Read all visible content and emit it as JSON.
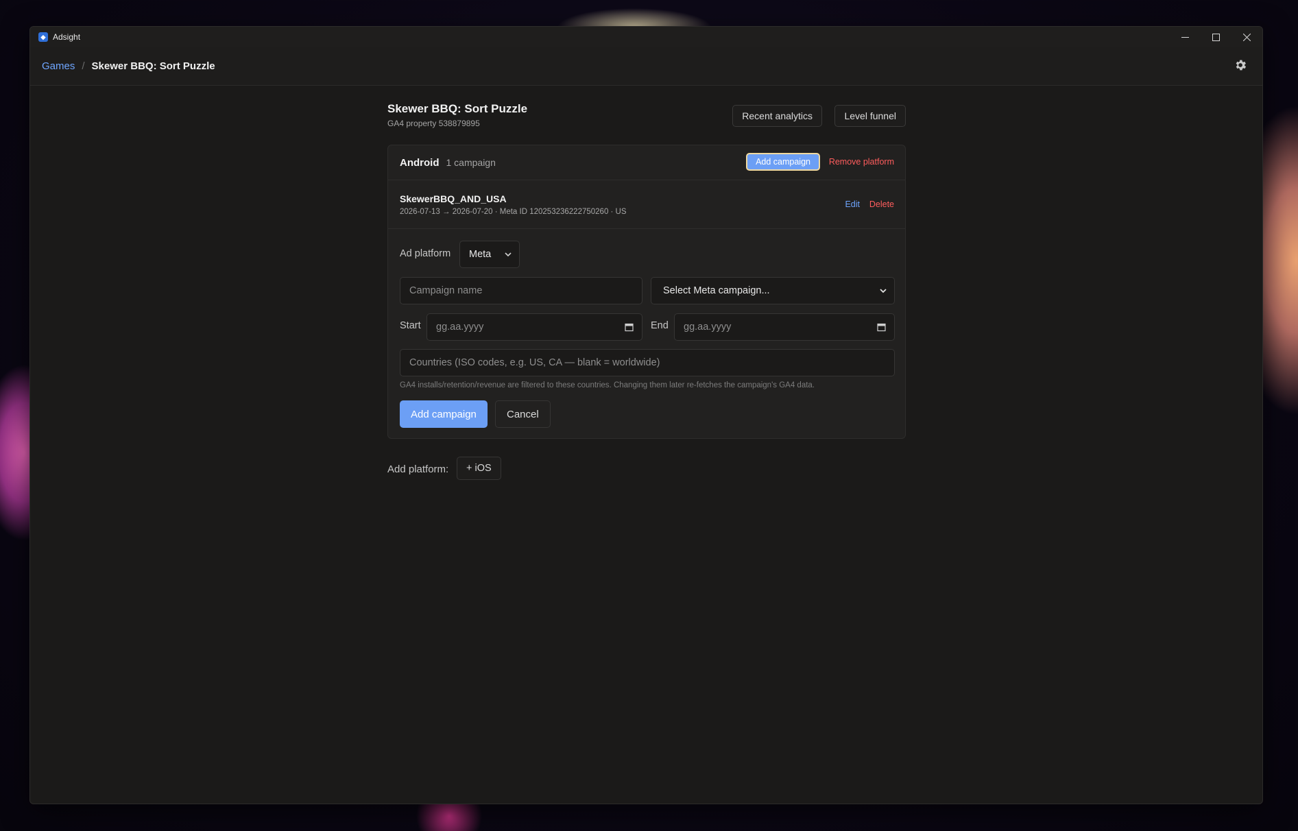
{
  "window": {
    "title": "Adsight"
  },
  "breadcrumb": {
    "games": "Games",
    "separator": "/",
    "current": "Skewer BBQ: Sort Puzzle"
  },
  "game": {
    "title": "Skewer BBQ: Sort Puzzle",
    "subtitle": "GA4 property 538879895",
    "recent_analytics": "Recent analytics",
    "level_funnel": "Level funnel"
  },
  "platform": {
    "name": "Android",
    "count": "1 campaign",
    "add_campaign": "Add campaign",
    "remove_platform": "Remove platform"
  },
  "campaigns": [
    {
      "name": "SkewerBBQ_AND_USA",
      "meta": "2026-07-13 → 2026-07-20 · Meta ID 120253236222750260 · US",
      "edit": "Edit",
      "delete": "Delete"
    }
  ],
  "form": {
    "ad_platform_label": "Ad platform",
    "ad_platform_value": "Meta",
    "campaign_name_placeholder": "Campaign name",
    "meta_campaign_select": "Select Meta campaign...",
    "start_label": "Start",
    "start_placeholder": "gg.aa.yyyy",
    "end_label": "End",
    "end_placeholder": "gg.aa.yyyy",
    "countries_placeholder": "Countries (ISO codes, e.g. US, CA — blank = worldwide)",
    "hint": "GA4 installs/retention/revenue are filtered to these countries. Changing them later re-fetches the campaign's GA4 data.",
    "submit": "Add campaign",
    "cancel": "Cancel"
  },
  "add_platform": {
    "label": "Add platform:",
    "ios": "+ iOS"
  },
  "colors": {
    "accent": "#6c9ff5",
    "link": "#6fa6ff",
    "danger": "#ff5d5d",
    "background": "#1b1a19"
  },
  "icons": {
    "settings": "gear-icon",
    "minimize": "minimize-icon",
    "maximize": "maximize-icon",
    "close": "close-icon"
  }
}
